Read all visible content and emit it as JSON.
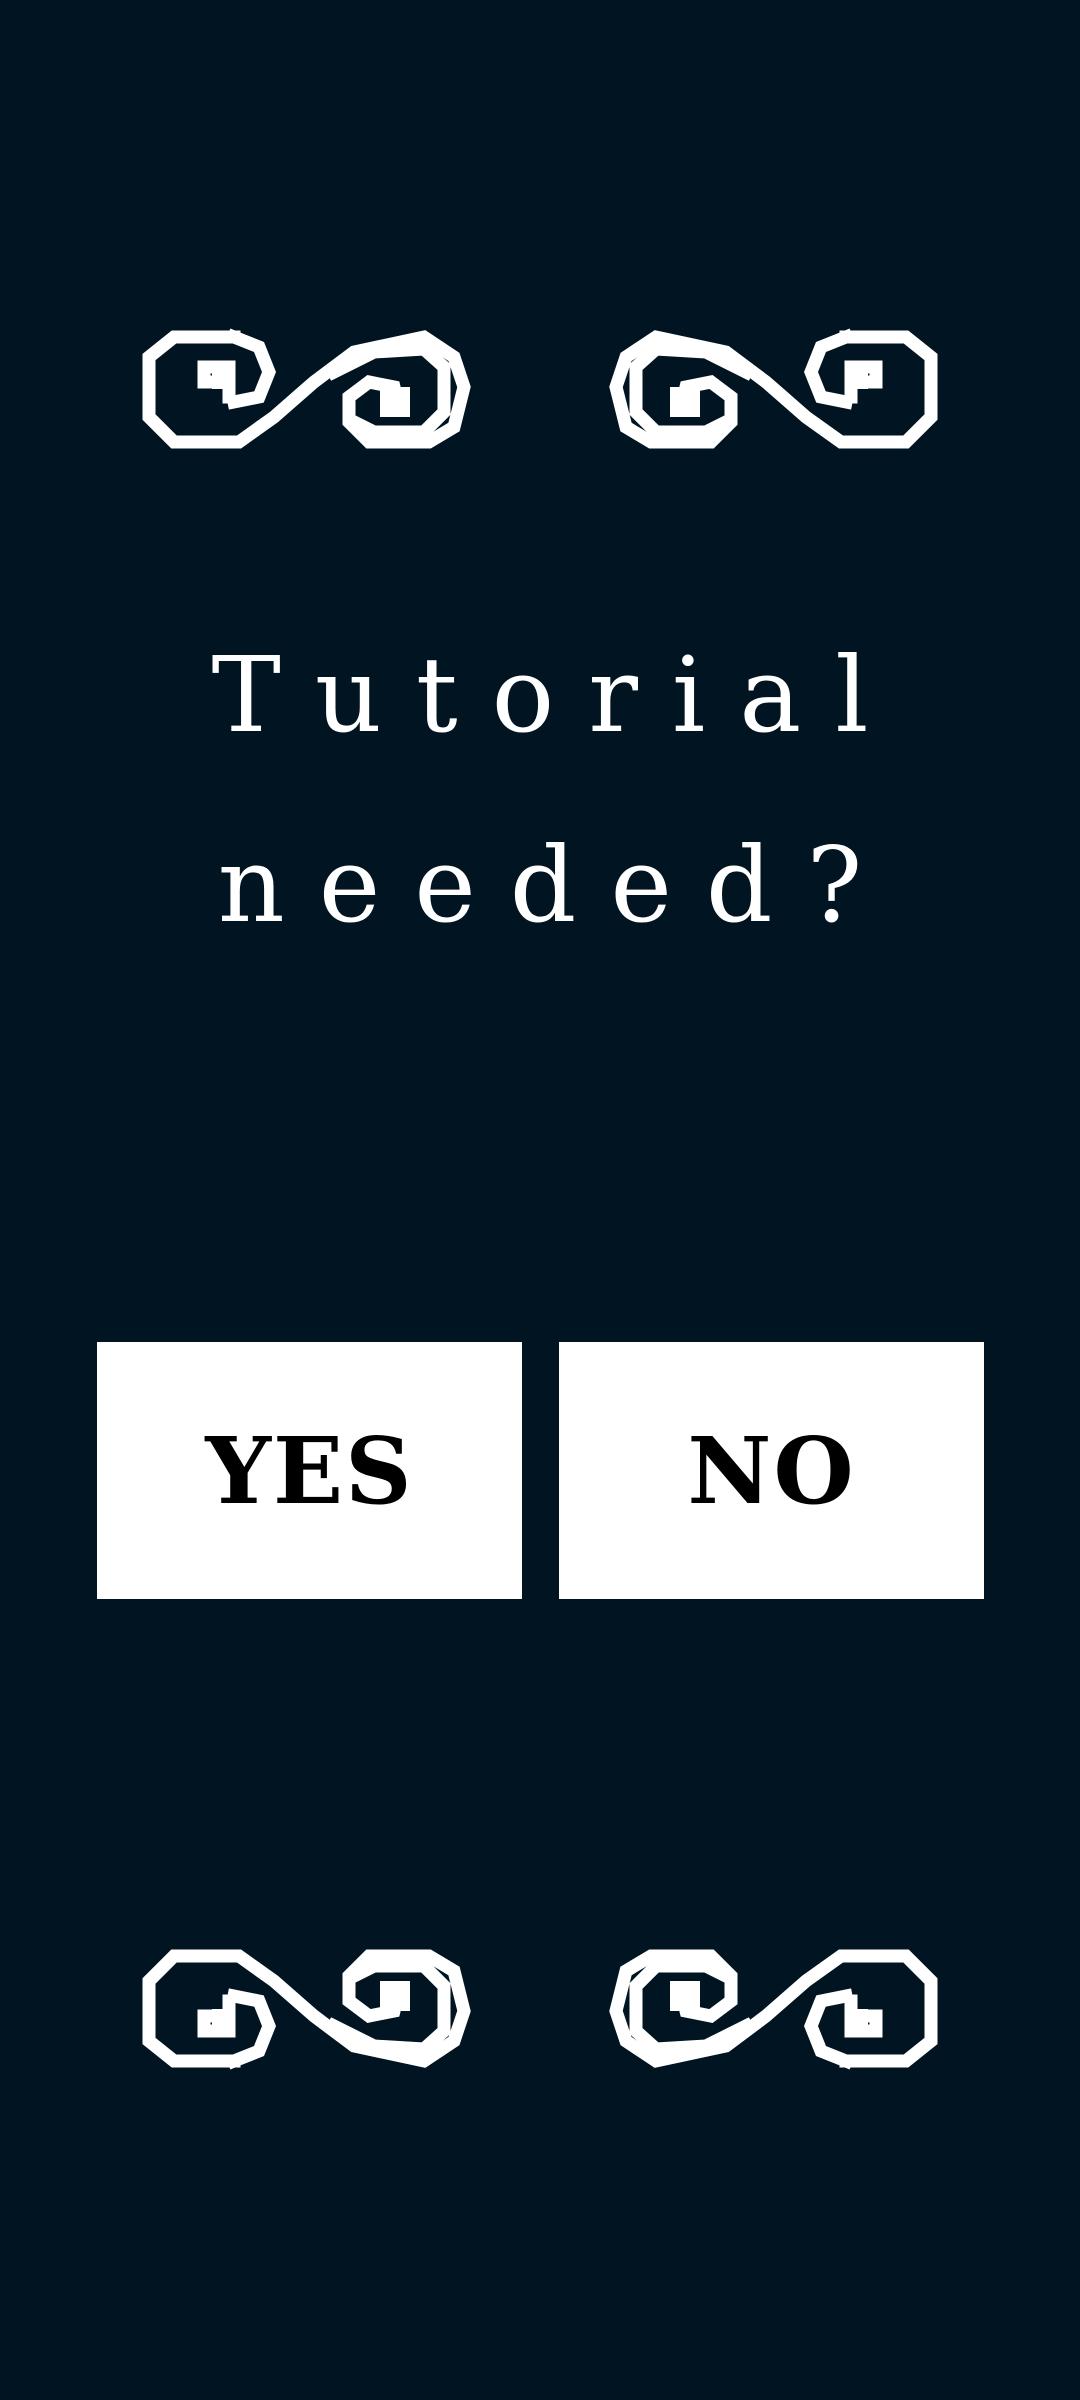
{
  "prompt": {
    "line1": "Tutorial",
    "line2": "needed?"
  },
  "buttons": {
    "yes_label": "YES",
    "no_label": "NO"
  },
  "colors": {
    "background": "#011421",
    "foreground": "#ffffff",
    "button_text": "#000000"
  },
  "icons": {
    "top": "swirl-ornament-icon",
    "bottom": "swirl-ornament-icon"
  }
}
